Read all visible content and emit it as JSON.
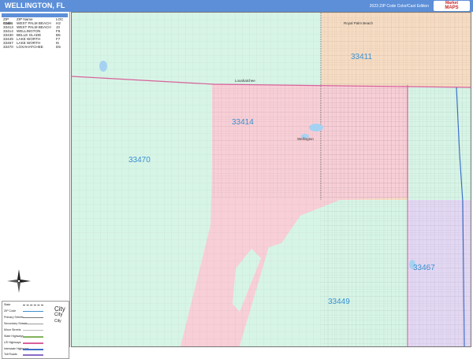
{
  "title": "WELLINGTON, FL",
  "edition": "2023 ZIP Code Color/Cast Edition",
  "logo": {
    "line1": "Market",
    "line2": "MAPS"
  },
  "zip_table": {
    "headers": [
      "ZIP Code",
      "ZIP Name",
      "LOC"
    ],
    "rows": [
      {
        "zip": "33411",
        "name": "WEST PALM BEACH",
        "loc": "H2"
      },
      {
        "zip": "33413",
        "name": "WEST PALM BEACH",
        "loc": "J3"
      },
      {
        "zip": "33414",
        "name": "WELLINGTON",
        "loc": "F5"
      },
      {
        "zip": "33430",
        "name": "BELLE GLADE",
        "loc": "B5"
      },
      {
        "zip": "33449",
        "name": "LAKE WORTH",
        "loc": "F7"
      },
      {
        "zip": "33467",
        "name": "LAKE WORTH",
        "loc": "I6"
      },
      {
        "zip": "33470",
        "name": "LOXAHATCHEE",
        "loc": "D5"
      }
    ]
  },
  "legend": {
    "rows": [
      "State",
      "ZIP Code",
      "Primary Streets",
      "Secondary Streets",
      "Minor Streets",
      "State Highways",
      "US Highways",
      "Interstate Highways",
      "Toll Roads"
    ],
    "city_big": "City",
    "city_mid": "City",
    "city_small": "City"
  },
  "map": {
    "zip_labels": [
      "33411",
      "33414",
      "33470",
      "33467",
      "33449"
    ],
    "place_labels": [
      "Loxahatchee",
      "Wellington",
      "Royal Palm Beach"
    ]
  },
  "colors": {
    "title_band": "#5d8fd8",
    "zone_33470": "#d7f5e7",
    "zone_33414": "#f8cfd7",
    "zone_33411": "#f6dcc3",
    "zone_33467": "#e3d8f3",
    "zone_33449": "#d7f5e7",
    "zip_label": "#3a8fd0",
    "highway": "#d8609a"
  }
}
